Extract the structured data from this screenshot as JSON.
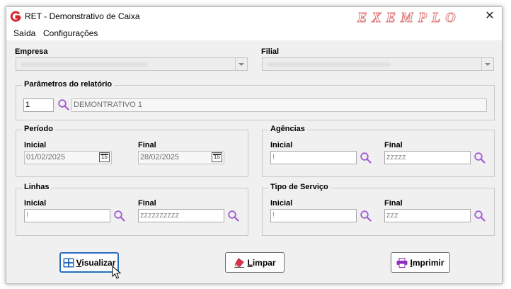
{
  "window": {
    "title": "RET - Demonstrativo de Caixa",
    "watermark": "EXEMPLO",
    "close_glyph": "✕"
  },
  "menu": {
    "items": [
      "Saída",
      "Configurações"
    ]
  },
  "empresa": {
    "label": "Empresa"
  },
  "filial": {
    "label": "Filial"
  },
  "parametros": {
    "title": "Parâmetros do relatório",
    "code": "1",
    "description": "DEMONTRATIVO 1"
  },
  "periodo": {
    "title": "Período",
    "inicial_label": "Inicial",
    "final_label": "Final",
    "inicial_value": "01/02/2025",
    "final_value": "28/02/2025",
    "calendar_glyph": "15"
  },
  "agencias": {
    "title": "Agências",
    "inicial_label": "Inicial",
    "final_label": "Final",
    "inicial_value": "!",
    "final_value": "zzzzz"
  },
  "linhas": {
    "title": "Linhas",
    "inicial_label": "Inicial",
    "final_label": "Final",
    "inicial_value": "!",
    "final_value": "zzzzzzzzzz"
  },
  "tipo_servico": {
    "title": "Tipo de Serviço",
    "inicial_label": "Inicial",
    "final_label": "Final",
    "inicial_value": "!",
    "final_value": "zzz"
  },
  "buttons": {
    "visualizar_first": "V",
    "visualizar_rest": "isualizar",
    "limpar_first": "L",
    "limpar_rest": "impar",
    "imprimir_first": "I",
    "imprimir_rest": "mprimir"
  },
  "colors": {
    "accent": "#2a6fbf",
    "search_icon": "#a35ad6",
    "eraser": "#e0304a",
    "printer": "#8e2bbf",
    "logo": "#d7262e"
  }
}
